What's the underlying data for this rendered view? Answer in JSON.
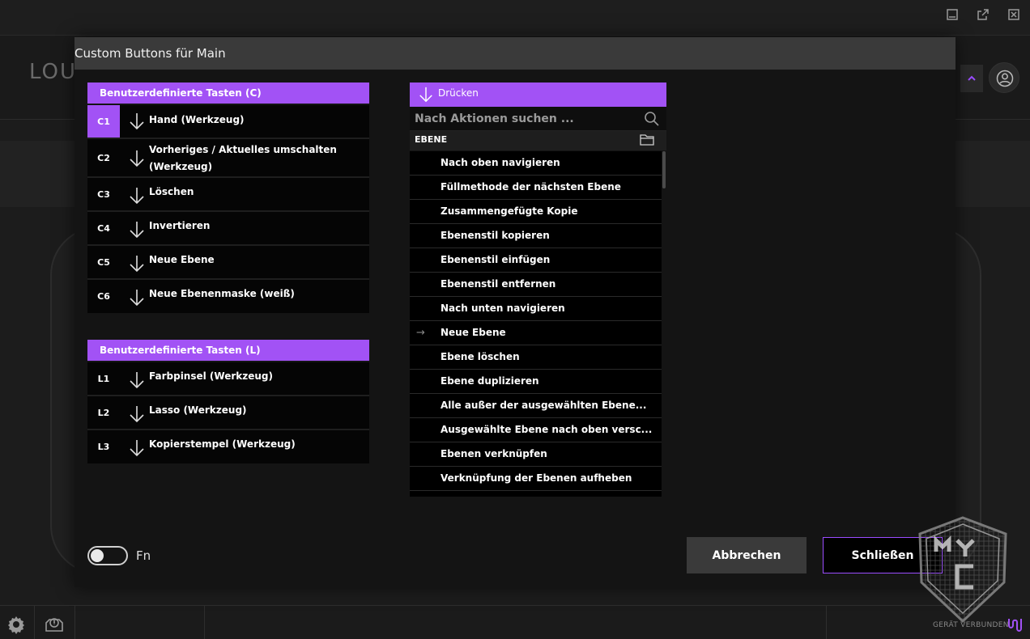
{
  "window": {
    "minimize_icon": "minimize-icon",
    "popout_icon": "popout-icon",
    "close_icon": "close-icon"
  },
  "background": {
    "logo_text": "LOU"
  },
  "modal": {
    "title": "Custom Buttons für Main",
    "c_panel": {
      "header": "Benutzerdefinierte Tasten (C)",
      "rows": [
        {
          "key": "C1",
          "label": "Hand (Werkzeug)",
          "active": true
        },
        {
          "key": "C2",
          "label": "Vorheriges / Aktuelles umschalten",
          "label2": "(Werkzeug)"
        },
        {
          "key": "C3",
          "label": "Löschen"
        },
        {
          "key": "C4",
          "label": "Invertieren"
        },
        {
          "key": "C5",
          "label": "Neue Ebene"
        },
        {
          "key": "C6",
          "label": "Neue Ebenenmaske (weiß)"
        }
      ]
    },
    "l_panel": {
      "header": "Benutzerdefinierte Tasten (L)",
      "rows": [
        {
          "key": "L1",
          "label": "Farbpinsel (Werkzeug)"
        },
        {
          "key": "L2",
          "label": "Lasso (Werkzeug)"
        },
        {
          "key": "L3",
          "label": "Kopierstempel (Werkzeug)"
        }
      ]
    },
    "action_panel": {
      "header": "Drücken",
      "search_placeholder": "Nach Aktionen suchen ...",
      "category": "EBENE",
      "selected_marker": "→",
      "items": [
        "Nach oben navigieren",
        "Füllmethode der nächsten Ebene",
        "Zusammengefügte Kopie",
        "Ebenenstil kopieren",
        "Ebenenstil einfügen",
        "Ebenenstil entfernen",
        "Nach unten navigieren",
        "Neue Ebene",
        "Ebene löschen",
        "Ebene duplizieren",
        "Alle außer der ausgewählten Ebene...",
        "Ausgewählte Ebene nach oben versc...",
        "Ebenen verknüpfen",
        "Verknüpfung der Ebenen aufheben"
      ],
      "selected_index": 7
    },
    "fn_toggle_label": "Fn",
    "fn_toggle_on": false,
    "cancel_label": "Abbrechen",
    "close_label": "Schließen"
  },
  "status": {
    "text": "GERÄT VERBUNDEN"
  },
  "colors": {
    "accent": "#a252f5",
    "active_key": "#a252f5"
  }
}
